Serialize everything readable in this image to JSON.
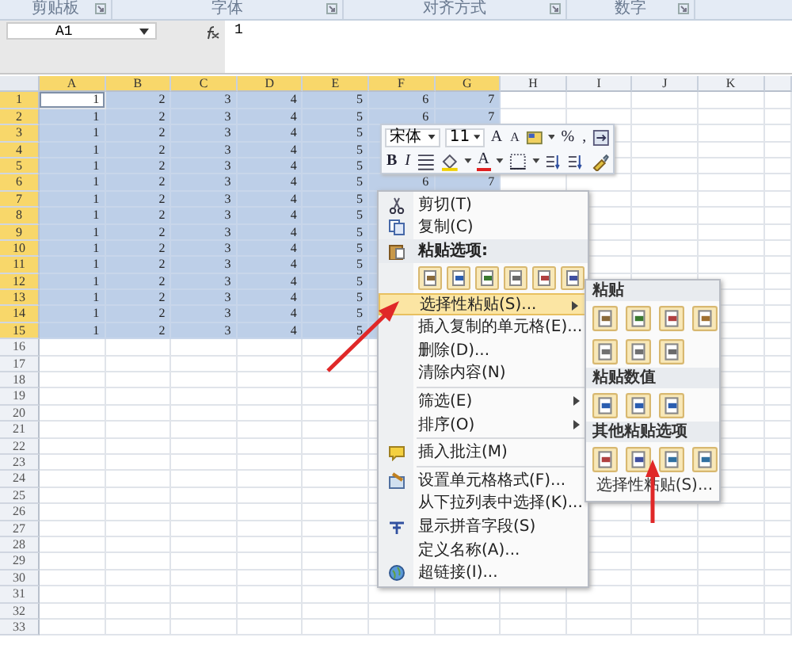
{
  "ribbon_groups": [
    {
      "label": "剪贴板"
    },
    {
      "label": "字体"
    },
    {
      "label": "对齐方式"
    },
    {
      "label": "数字"
    }
  ],
  "formula_bar": {
    "name_box": "A1",
    "formula": "1"
  },
  "columns": [
    {
      "label": "A",
      "selected": true
    },
    {
      "label": "B",
      "selected": true
    },
    {
      "label": "C",
      "selected": true
    },
    {
      "label": "D",
      "selected": true
    },
    {
      "label": "E",
      "selected": true
    },
    {
      "label": "F",
      "selected": true
    },
    {
      "label": "G",
      "selected": true
    },
    {
      "label": "H",
      "selected": false
    },
    {
      "label": "I",
      "selected": false
    },
    {
      "label": "J",
      "selected": false
    },
    {
      "label": "K",
      "selected": false
    }
  ],
  "rows": [
    {
      "header": "1",
      "selected": true,
      "cells": [
        {
          "value": "1",
          "active": true
        },
        {
          "value": "2",
          "active": false
        },
        {
          "value": "3",
          "active": false
        },
        {
          "value": "4",
          "active": false
        },
        {
          "value": "5",
          "active": false
        },
        {
          "value": "6",
          "active": false
        },
        {
          "value": "7",
          "active": false
        }
      ]
    },
    {
      "header": "2",
      "selected": true,
      "cells": [
        {
          "value": "1",
          "active": false
        },
        {
          "value": "2",
          "active": false
        },
        {
          "value": "3",
          "active": false
        },
        {
          "value": "4",
          "active": false
        },
        {
          "value": "5",
          "active": false
        },
        {
          "value": "6",
          "active": false
        },
        {
          "value": "7",
          "active": false
        }
      ]
    },
    {
      "header": "3",
      "selected": true,
      "cells": [
        {
          "value": "1",
          "active": false
        },
        {
          "value": "2",
          "active": false
        },
        {
          "value": "3",
          "active": false
        },
        {
          "value": "4",
          "active": false
        },
        {
          "value": "5",
          "active": false
        }
      ]
    },
    {
      "header": "4",
      "selected": true,
      "cells": [
        {
          "value": "1",
          "active": false
        },
        {
          "value": "2",
          "active": false
        },
        {
          "value": "3",
          "active": false
        },
        {
          "value": "4",
          "active": false
        },
        {
          "value": "5",
          "active": false
        }
      ]
    },
    {
      "header": "5",
      "selected": true,
      "cells": [
        {
          "value": "1",
          "active": false
        },
        {
          "value": "2",
          "active": false
        },
        {
          "value": "3",
          "active": false
        },
        {
          "value": "4",
          "active": false
        },
        {
          "value": "5",
          "active": false
        }
      ]
    },
    {
      "header": "6",
      "selected": true,
      "cells": [
        {
          "value": "1",
          "active": false
        },
        {
          "value": "2",
          "active": false
        },
        {
          "value": "3",
          "active": false
        },
        {
          "value": "4",
          "active": false
        },
        {
          "value": "5",
          "active": false
        },
        {
          "value": "6",
          "active": false
        },
        {
          "value": "7",
          "active": false
        }
      ]
    },
    {
      "header": "7",
      "selected": true,
      "cells": [
        {
          "value": "1",
          "active": false
        },
        {
          "value": "2",
          "active": false
        },
        {
          "value": "3",
          "active": false
        },
        {
          "value": "4",
          "active": false
        },
        {
          "value": "5",
          "active": false
        }
      ]
    },
    {
      "header": "8",
      "selected": true,
      "cells": [
        {
          "value": "1",
          "active": false
        },
        {
          "value": "2",
          "active": false
        },
        {
          "value": "3",
          "active": false
        },
        {
          "value": "4",
          "active": false
        },
        {
          "value": "5",
          "active": false
        }
      ]
    },
    {
      "header": "9",
      "selected": true,
      "cells": [
        {
          "value": "1",
          "active": false
        },
        {
          "value": "2",
          "active": false
        },
        {
          "value": "3",
          "active": false
        },
        {
          "value": "4",
          "active": false
        },
        {
          "value": "5",
          "active": false
        }
      ]
    },
    {
      "header": "10",
      "selected": true,
      "cells": [
        {
          "value": "1",
          "active": false
        },
        {
          "value": "2",
          "active": false
        },
        {
          "value": "3",
          "active": false
        },
        {
          "value": "4",
          "active": false
        },
        {
          "value": "5",
          "active": false
        }
      ]
    },
    {
      "header": "11",
      "selected": true,
      "cells": [
        {
          "value": "1",
          "active": false
        },
        {
          "value": "2",
          "active": false
        },
        {
          "value": "3",
          "active": false
        },
        {
          "value": "4",
          "active": false
        },
        {
          "value": "5",
          "active": false
        }
      ]
    },
    {
      "header": "12",
      "selected": true,
      "cells": [
        {
          "value": "1",
          "active": false
        },
        {
          "value": "2",
          "active": false
        },
        {
          "value": "3",
          "active": false
        },
        {
          "value": "4",
          "active": false
        },
        {
          "value": "5",
          "active": false
        }
      ]
    },
    {
      "header": "13",
      "selected": true,
      "cells": [
        {
          "value": "1",
          "active": false
        },
        {
          "value": "2",
          "active": false
        },
        {
          "value": "3",
          "active": false
        },
        {
          "value": "4",
          "active": false
        },
        {
          "value": "5",
          "active": false
        }
      ]
    },
    {
      "header": "14",
      "selected": true,
      "cells": [
        {
          "value": "1",
          "active": false
        },
        {
          "value": "2",
          "active": false
        },
        {
          "value": "3",
          "active": false
        },
        {
          "value": "4",
          "active": false
        },
        {
          "value": "5",
          "active": false
        }
      ]
    },
    {
      "header": "15",
      "selected": true,
      "cells": [
        {
          "value": "1",
          "active": false
        },
        {
          "value": "2",
          "active": false
        },
        {
          "value": "3",
          "active": false
        },
        {
          "value": "4",
          "active": false
        },
        {
          "value": "5",
          "active": false
        }
      ]
    },
    {
      "header": "16",
      "selected": false,
      "cells": []
    },
    {
      "header": "17",
      "selected": false,
      "cells": []
    },
    {
      "header": "18",
      "selected": false,
      "cells": []
    },
    {
      "header": "19",
      "selected": false,
      "cells": []
    },
    {
      "header": "20",
      "selected": false,
      "cells": []
    },
    {
      "header": "21",
      "selected": false,
      "cells": []
    },
    {
      "header": "22",
      "selected": false,
      "cells": []
    },
    {
      "header": "23",
      "selected": false,
      "cells": []
    },
    {
      "header": "24",
      "selected": false,
      "cells": []
    },
    {
      "header": "25",
      "selected": false,
      "cells": []
    },
    {
      "header": "26",
      "selected": false,
      "cells": []
    },
    {
      "header": "27",
      "selected": false,
      "cells": []
    },
    {
      "header": "28",
      "selected": false,
      "cells": []
    },
    {
      "header": "29",
      "selected": false,
      "cells": []
    },
    {
      "header": "30",
      "selected": false,
      "cells": []
    },
    {
      "header": "31",
      "selected": false,
      "cells": []
    },
    {
      "header": "32",
      "selected": false,
      "cells": []
    },
    {
      "header": "33",
      "selected": false,
      "cells": []
    }
  ],
  "mini_toolbar": {
    "font": "宋体",
    "size": "11",
    "row1": [
      {
        "kind": "grow",
        "label": "A",
        "caret": false
      },
      {
        "kind": "shrink",
        "label": "A",
        "caret": false
      },
      {
        "kind": "styles",
        "caret": true
      },
      {
        "kind": "text",
        "label": "%",
        "caret": false
      },
      {
        "kind": "text",
        "label": ",",
        "caret": false
      },
      {
        "kind": "merge",
        "caret": false
      }
    ],
    "row2": [
      {
        "kind": "bold",
        "label": "B",
        "caret": false
      },
      {
        "kind": "italic",
        "label": "I",
        "caret": false
      },
      {
        "kind": "align",
        "caret": false
      },
      {
        "kind": "fill",
        "caret": true
      },
      {
        "kind": "color",
        "label": "A",
        "caret": true
      },
      {
        "kind": "border",
        "caret": true
      },
      {
        "kind": "decimal",
        "caret": false
      },
      {
        "kind": "decimal2",
        "caret": false
      },
      {
        "kind": "brush",
        "caret": false
      }
    ]
  },
  "context_menu": [
    {
      "kind": "cut",
      "label": "剪切(T)",
      "submenu": false,
      "selected": false
    },
    {
      "kind": "copy",
      "label": "复制(C)",
      "submenu": false,
      "selected": false
    },
    {
      "kind": "header",
      "label": "粘贴选项:"
    },
    {
      "kind": "icons",
      "items": [
        {
          "kind": "clipboard"
        },
        {
          "kind": "values"
        },
        {
          "kind": "formula"
        },
        {
          "kind": "transpose"
        },
        {
          "kind": "format"
        },
        {
          "kind": "link"
        }
      ]
    },
    {
      "kind": "item",
      "label": "选择性粘贴(S)...",
      "submenu": true,
      "selected": true
    },
    {
      "kind": "item",
      "label": "插入复制的单元格(E)...",
      "submenu": false,
      "selected": false
    },
    {
      "kind": "item",
      "label": "删除(D)...",
      "submenu": false,
      "selected": false
    },
    {
      "kind": "item",
      "label": "清除内容(N)",
      "submenu": false,
      "selected": false
    },
    {
      "kind": "separator"
    },
    {
      "kind": "item",
      "label": "筛选(E)",
      "submenu": true,
      "selected": false
    },
    {
      "kind": "item",
      "label": "排序(O)",
      "submenu": true,
      "selected": false
    },
    {
      "kind": "separator"
    },
    {
      "kind": "comment",
      "label": "插入批注(M)",
      "submenu": false,
      "selected": false
    },
    {
      "kind": "separator"
    },
    {
      "kind": "format",
      "label": "设置单元格格式(F)...",
      "submenu": false,
      "selected": false
    },
    {
      "kind": "item",
      "label": "从下拉列表中选择(K)...",
      "submenu": false,
      "selected": false
    },
    {
      "kind": "phonetic",
      "label": "显示拼音字段(S)",
      "submenu": false,
      "selected": false
    },
    {
      "kind": "item",
      "label": "定义名称(A)...",
      "submenu": false,
      "selected": false
    },
    {
      "kind": "link",
      "label": "超链接(I)...",
      "submenu": false,
      "selected": false
    }
  ],
  "submenu": [
    {
      "kind": "header",
      "label": "粘贴"
    },
    {
      "kind": "icons",
      "items": [
        {
          "kind": "clipboard"
        },
        {
          "kind": "formula"
        },
        {
          "kind": "format"
        },
        {
          "kind": "brush"
        }
      ]
    },
    {
      "kind": "icons",
      "items": [
        {
          "kind": "noborder"
        },
        {
          "kind": "width"
        },
        {
          "kind": "transpose"
        }
      ]
    },
    {
      "kind": "header",
      "label": "粘贴数值"
    },
    {
      "kind": "icons",
      "items": [
        {
          "kind": "values"
        },
        {
          "kind": "values"
        },
        {
          "kind": "values"
        }
      ]
    },
    {
      "kind": "header",
      "label": "其他粘贴选项"
    },
    {
      "kind": "icons",
      "items": [
        {
          "kind": "format"
        },
        {
          "kind": "link"
        },
        {
          "kind": "picture"
        },
        {
          "kind": "picture"
        }
      ]
    },
    {
      "kind": "item",
      "label": "选择性粘贴(S)..."
    }
  ]
}
